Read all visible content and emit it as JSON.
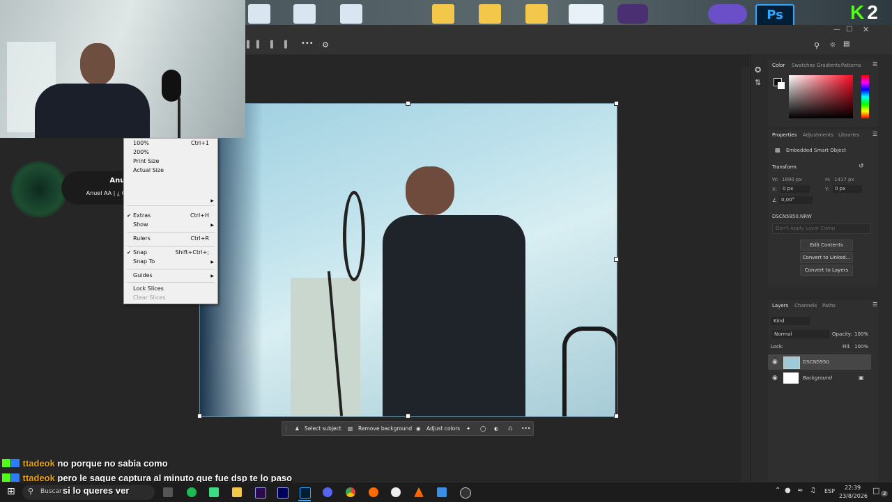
{
  "desktop": {
    "logo_text": "K",
    "logo_number": "2"
  },
  "photoshop": {
    "color_panel": {
      "tabs": [
        "Color",
        "Swatches",
        "Gradients",
        "Patterns"
      ]
    },
    "properties_panel": {
      "tabs": [
        "Properties",
        "Adjustments",
        "Libraries"
      ],
      "object_type": "Embedded Smart Object",
      "transform_label": "Transform",
      "w_label": "W:",
      "w_value": "1890 px",
      "h_label": "H:",
      "h_value": "1417 px",
      "x_label": "X:",
      "x_value": "0 px",
      "y_label": "Y:",
      "y_value": "0 px",
      "angle_value": "0,00°",
      "file_name": "DSCN5950.NRW",
      "layer_comp_placeholder": "Don't Apply Layer Comp",
      "buttons": [
        "Edit Contents",
        "Convert to Linked...",
        "Convert to Layers"
      ]
    },
    "layers_panel": {
      "tabs": [
        "Layers",
        "Channels",
        "Paths"
      ],
      "filter_kind": "Kind",
      "blend_mode": "Normal",
      "opacity_label": "Opacity:",
      "opacity_value": "100%",
      "lock_label": "Lock:",
      "fill_label": "Fill:",
      "fill_value": "100%",
      "layers": [
        {
          "name": "DSCN5950"
        },
        {
          "name": "Background"
        }
      ]
    },
    "context_toolbar": {
      "select_subject": "Select subject",
      "remove_background": "Remove background",
      "adjust_colors": "Adjust colors",
      "more": "•••"
    },
    "options_more": "•••"
  },
  "context_menu": {
    "items": [
      {
        "label": "100%",
        "shortcut": "Ctrl+1"
      },
      {
        "label": "200%",
        "shortcut": ""
      },
      {
        "label": "Print Size",
        "shortcut": ""
      },
      {
        "label": "Actual Size",
        "shortcut": ""
      },
      {
        "label": "Extras",
        "shortcut": "Ctrl+H",
        "checked": true
      },
      {
        "label": "Show",
        "shortcut": ""
      },
      {
        "label": "Rulers",
        "shortcut": "Ctrl+R"
      },
      {
        "label": "Snap",
        "shortcut": "Shift+Ctrl+;",
        "checked": true
      },
      {
        "label": "Snap To",
        "shortcut": ""
      },
      {
        "label": "Guides",
        "shortcut": ""
      },
      {
        "label": "Lock Slices",
        "shortcut": ""
      },
      {
        "label": "Clear Slices",
        "shortcut": "",
        "disabled": true
      }
    ]
  },
  "notification": {
    "title": "Anuel AA",
    "body": "Anuel AA | ¿ QUE NOS PASO ?"
  },
  "chat": {
    "messages": [
      {
        "user": "ttadeok",
        "text": "no porque no sabia como"
      },
      {
        "user": "ttadeok",
        "text": "pero le saque captura al minuto que fue dsp te lo paso"
      },
      {
        "user": "",
        "text": "si lo queres ver"
      }
    ],
    "user_color": "#e8a317"
  },
  "taskbar": {
    "search_placeholder": "Buscar",
    "language": "ESP",
    "time": "22:39",
    "date": "23/8/2026",
    "notification_count": "2"
  }
}
